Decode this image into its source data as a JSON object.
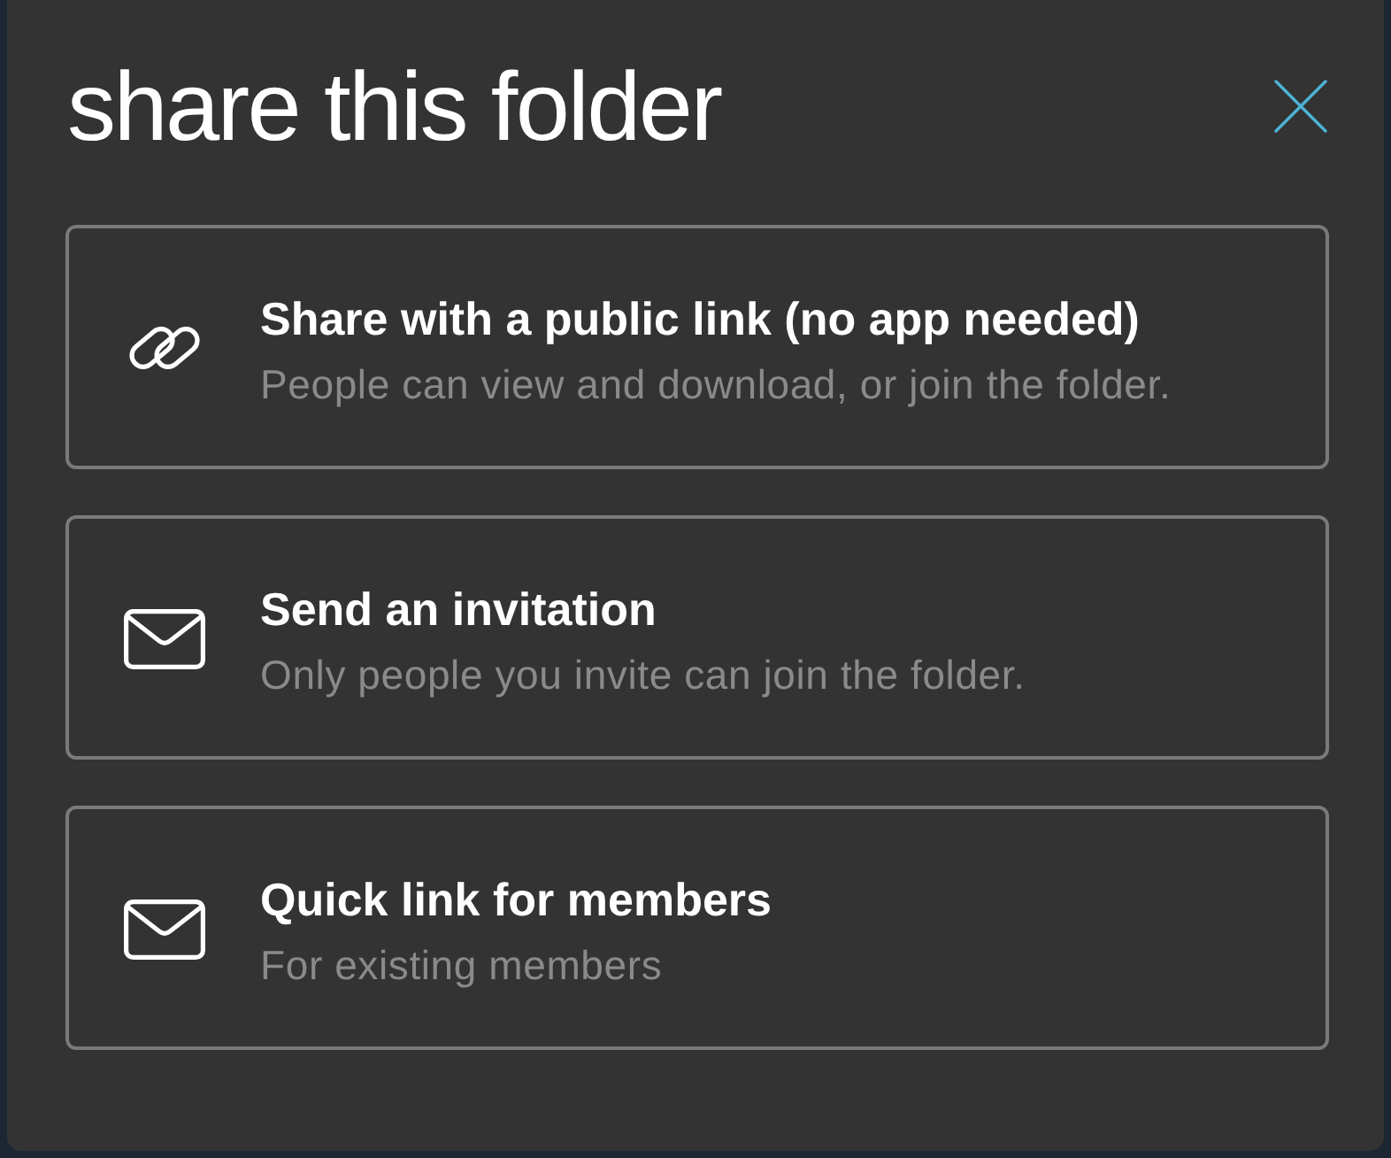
{
  "dialog": {
    "title": "share this folder"
  },
  "options": [
    {
      "kind": "link",
      "title": "Share with a public link (no app needed)",
      "description": "People can view and download, or join the folder."
    },
    {
      "kind": "mail",
      "title": "Send an invitation",
      "description": "Only people you invite can join the folder."
    },
    {
      "kind": "mail",
      "title": "Quick link for members",
      "description": "For existing members"
    }
  ]
}
